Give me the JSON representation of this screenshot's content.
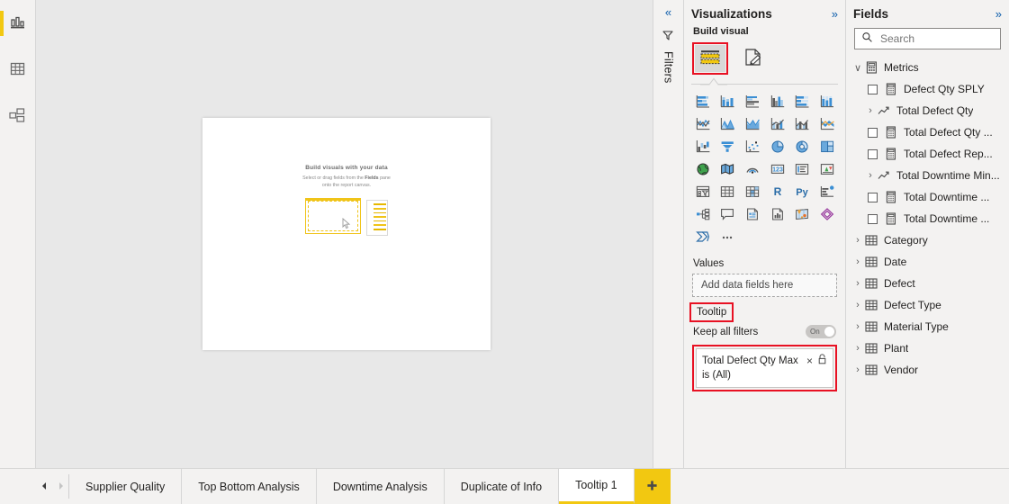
{
  "left_rail": {
    "items": [
      {
        "name": "report-view",
        "icon": "bar-chart-icon",
        "selected": true
      },
      {
        "name": "data-view",
        "icon": "table-icon",
        "selected": false
      },
      {
        "name": "model-view",
        "icon": "model-relationships-icon",
        "selected": false
      }
    ]
  },
  "canvas": {
    "placeholder_title": "Build visuals with your data",
    "placeholder_line1_a": "Select or drag fields from the ",
    "placeholder_line1_b": "Fields",
    "placeholder_line1_c": " pane",
    "placeholder_line2": "onto the report canvas."
  },
  "filters_pane": {
    "collapse_icon": "«",
    "funnel_icon": "filter-funnel-icon",
    "title": "Filters"
  },
  "visualizations": {
    "title": "Visualizations",
    "expand_icon": "»",
    "build_label": "Build visual",
    "build_tab_icon": "build-visual-icon",
    "format_tab_icon": "format-visual-icon",
    "highlight_color": "#e81123",
    "visual_icons": [
      "stacked-bar-chart",
      "stacked-column-chart",
      "clustered-bar-chart",
      "clustered-column-chart",
      "100-stacked-bar-chart",
      "100-stacked-column-chart",
      "line-chart",
      "area-chart",
      "stacked-area-chart",
      "line-and-stacked-column-chart",
      "line-and-clustered-column-chart",
      "ribbon-chart",
      "waterfall-chart",
      "funnel-chart",
      "scatter-chart",
      "pie-chart",
      "donut-chart",
      "treemap",
      "map",
      "filled-map",
      "azure-map",
      "card",
      "multi-row-card",
      "kpi",
      "slicer",
      "table",
      "matrix",
      "r-script-visual",
      "python-visual",
      "key-influencers",
      "decomposition-tree",
      "q-and-a",
      "narrative",
      "paginated-report",
      "arcgis-map",
      "power-apps",
      "power-automate",
      "more-options"
    ],
    "values_label": "Values",
    "values_placeholder": "Add data fields here",
    "tooltip_label": "Tooltip",
    "keep_all_filters_label": "Keep all filters",
    "keep_all_filters_state": "On",
    "filter_card": {
      "field_name": "Total Defect Qty Max",
      "remove_icon": "×",
      "lock_icon": "lock-icon",
      "condition": "is (All)"
    }
  },
  "fields": {
    "title": "Fields",
    "expand_icon": "»",
    "search_placeholder": "Search",
    "search_value": "",
    "items": [
      {
        "label": "Metrics",
        "type": "table-group",
        "icon": "metrics-table-icon",
        "caret": "∨",
        "indent": 0,
        "checkbox": false
      },
      {
        "label": "Defect Qty SPLY",
        "type": "measure",
        "icon": "measure-icon",
        "caret": "",
        "indent": 2,
        "checkbox": true
      },
      {
        "label": "Total Defect Qty",
        "type": "folder",
        "icon": "trend-icon",
        "caret": "›",
        "indent": 1,
        "checkbox": false
      },
      {
        "label": "Total Defect Qty ...",
        "type": "measure",
        "icon": "measure-icon",
        "caret": "",
        "indent": 2,
        "checkbox": true
      },
      {
        "label": "Total Defect Rep...",
        "type": "measure",
        "icon": "measure-icon",
        "caret": "",
        "indent": 2,
        "checkbox": true
      },
      {
        "label": "Total Downtime Min...",
        "type": "folder",
        "icon": "trend-icon",
        "caret": "›",
        "indent": 1,
        "checkbox": false
      },
      {
        "label": "Total Downtime ...",
        "type": "measure",
        "icon": "measure-icon",
        "caret": "",
        "indent": 2,
        "checkbox": true
      },
      {
        "label": "Total Downtime ...",
        "type": "measure",
        "icon": "measure-icon",
        "caret": "",
        "indent": 2,
        "checkbox": true
      },
      {
        "label": "Category",
        "type": "table",
        "icon": "table-icon",
        "caret": "›",
        "indent": 0,
        "checkbox": false
      },
      {
        "label": "Date",
        "type": "table",
        "icon": "table-icon",
        "caret": "›",
        "indent": 0,
        "checkbox": false
      },
      {
        "label": "Defect",
        "type": "table",
        "icon": "table-icon",
        "caret": "›",
        "indent": 0,
        "checkbox": false
      },
      {
        "label": "Defect Type",
        "type": "table",
        "icon": "table-icon",
        "caret": "›",
        "indent": 0,
        "checkbox": false
      },
      {
        "label": "Material Type",
        "type": "table",
        "icon": "table-icon",
        "caret": "›",
        "indent": 0,
        "checkbox": false
      },
      {
        "label": "Plant",
        "type": "table",
        "icon": "table-icon",
        "caret": "›",
        "indent": 0,
        "checkbox": false
      },
      {
        "label": "Vendor",
        "type": "table",
        "icon": "table-icon",
        "caret": "›",
        "indent": 0,
        "checkbox": false
      }
    ]
  },
  "tabbar": {
    "prev_icon": "◄",
    "next_icon": "►",
    "tabs": [
      {
        "label": "Supplier Quality",
        "active": false
      },
      {
        "label": "Top Bottom Analysis",
        "active": false
      },
      {
        "label": "Downtime Analysis",
        "active": false
      },
      {
        "label": "Duplicate of Info",
        "active": false
      },
      {
        "label": "Tooltip 1",
        "active": true
      }
    ],
    "add_label": "+",
    "accent_color": "#f2c811"
  }
}
